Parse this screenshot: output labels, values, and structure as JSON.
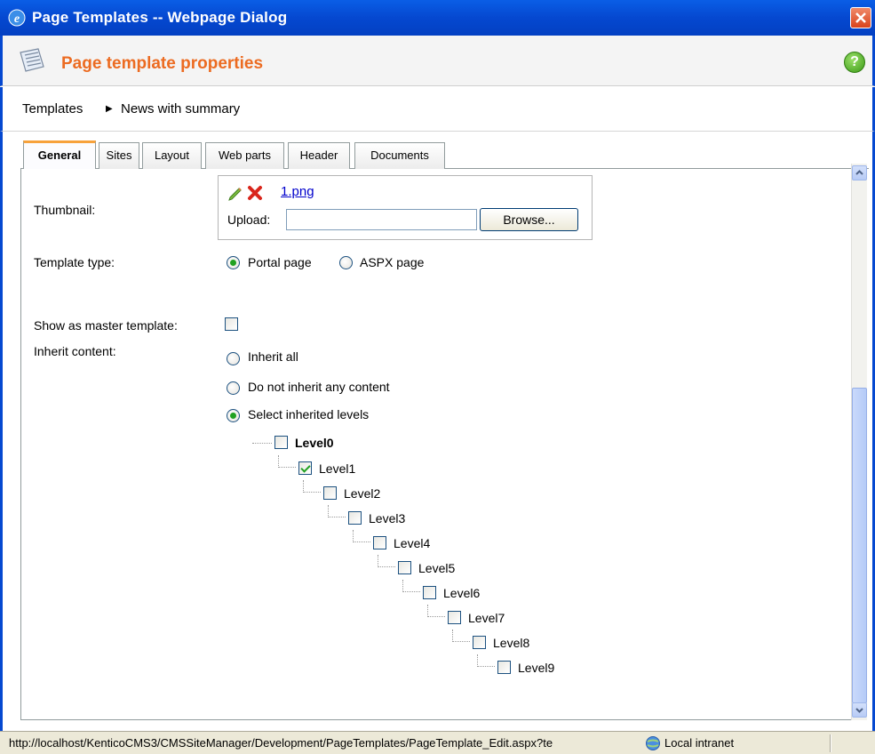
{
  "window": {
    "title": "Page Templates -- Webpage Dialog"
  },
  "header": {
    "title": "Page template properties",
    "help_label": "?"
  },
  "breadcrumb": {
    "root": "Templates",
    "current": "News with summary"
  },
  "tabs": [
    {
      "label": "General",
      "active": true
    },
    {
      "label": "Sites"
    },
    {
      "label": "Layout"
    },
    {
      "label": "Web parts"
    },
    {
      "label": "Header"
    },
    {
      "label": "Documents"
    }
  ],
  "form": {
    "thumbnail_label": "Thumbnail:",
    "thumbnail_file": "1.png",
    "upload_label": "Upload:",
    "upload_value": "",
    "browse_label": "Browse...",
    "template_type_label": "Template type:",
    "template_type_options": [
      {
        "label": "Portal page",
        "selected": true
      },
      {
        "label": "ASPX page",
        "selected": false
      }
    ],
    "master_label": "Show as master template:",
    "master_checked": false,
    "inherit_label": "Inherit content:",
    "inherit_options": [
      {
        "label": "Inherit all",
        "selected": false
      },
      {
        "label": "Do not inherit any content",
        "selected": false
      },
      {
        "label": "Select inherited levels",
        "selected": true
      }
    ],
    "levels": [
      {
        "label": "Level0",
        "checked": false,
        "bold": true
      },
      {
        "label": "Level1",
        "checked": true
      },
      {
        "label": "Level2",
        "checked": false
      },
      {
        "label": "Level3",
        "checked": false
      },
      {
        "label": "Level4",
        "checked": false
      },
      {
        "label": "Level5",
        "checked": false
      },
      {
        "label": "Level6",
        "checked": false
      },
      {
        "label": "Level7",
        "checked": false
      },
      {
        "label": "Level8",
        "checked": false
      },
      {
        "label": "Level9",
        "checked": false
      }
    ]
  },
  "status": {
    "url": "http://localhost/KenticoCMS3/CMSSiteManager/Development/PageTemplates/PageTemplate_Edit.aspx?te",
    "zone": "Local intranet"
  },
  "colors": {
    "title_bar": "#0548d0",
    "accent_orange": "#ec6b21",
    "link": "#0000cc",
    "check_green": "#21a121"
  }
}
